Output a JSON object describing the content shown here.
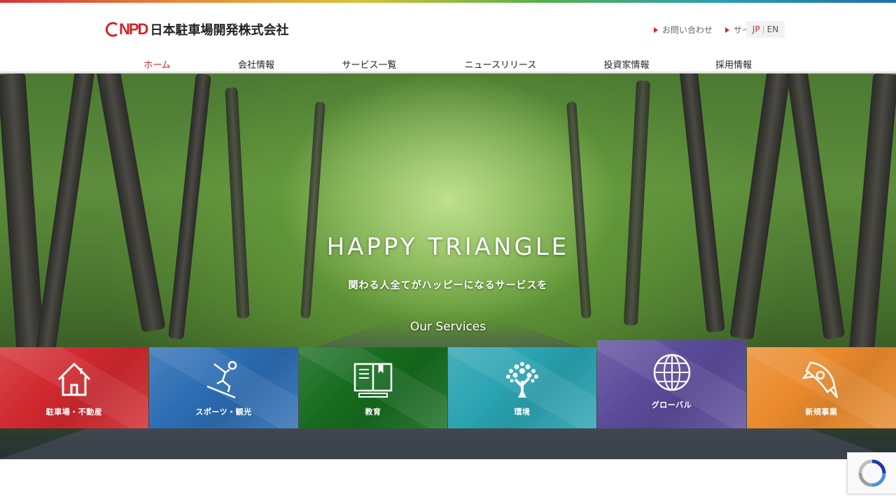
{
  "header": {
    "logo_mark": "NPD",
    "company_name": "日本駐車場開発株式会社",
    "util_links": [
      {
        "label": "お問い合わせ"
      },
      {
        "label": "サイトマップ"
      }
    ],
    "lang": {
      "jp": "JP",
      "separator": "|",
      "en": "EN"
    }
  },
  "nav": {
    "items": [
      {
        "label": "ホーム",
        "active": true
      },
      {
        "label": "会社情報"
      },
      {
        "label": "サービス一覧"
      },
      {
        "label": "ニュースリリース"
      },
      {
        "label": "投資家情報"
      },
      {
        "label": "採用情報"
      }
    ]
  },
  "hero": {
    "title": "HAPPY TRIANGLE",
    "subtitle": "関わる人全てがハッピーになるサービスを",
    "services_label": "Our Services"
  },
  "services": [
    {
      "label": "駐車場・不動産",
      "icon": "house-icon",
      "color": "#d0282e"
    },
    {
      "label": "スポーツ・観光",
      "icon": "skier-icon",
      "color": "#2c6db3"
    },
    {
      "label": "教育",
      "icon": "book-icon",
      "color": "#166b1e"
    },
    {
      "label": "環境",
      "icon": "tree-icon",
      "color": "#2aa3b1"
    },
    {
      "label": "グローバル",
      "icon": "globe-icon",
      "color": "#5a4b9a"
    },
    {
      "label": "新規事業",
      "icon": "rocket-icon",
      "color": "#ea8a2c"
    }
  ],
  "colors": {
    "accent": "#d2232a"
  }
}
